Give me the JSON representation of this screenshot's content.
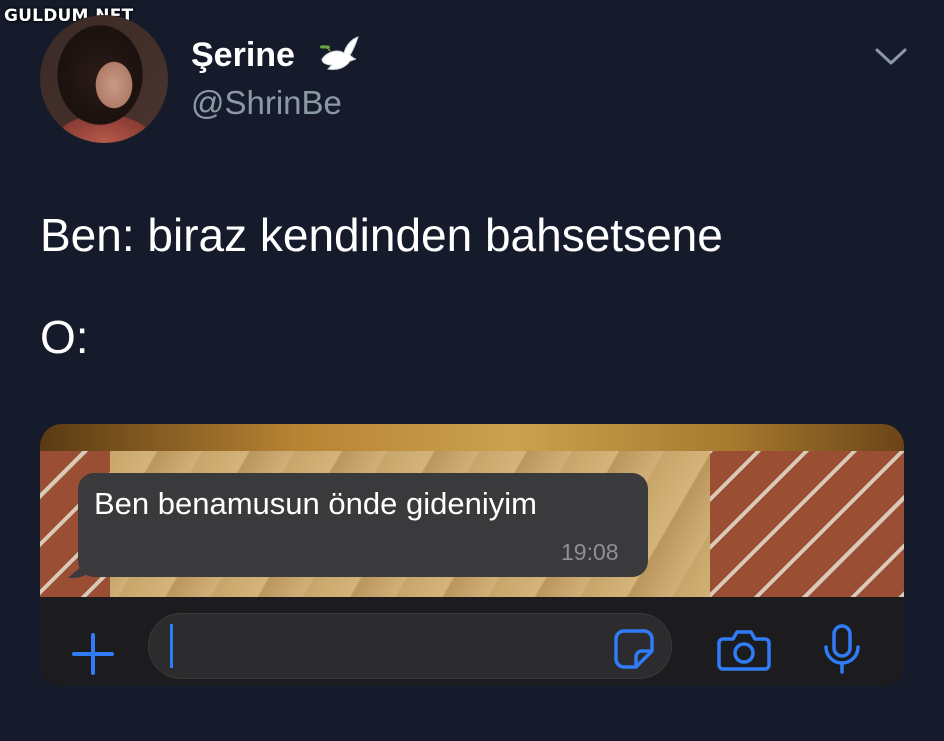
{
  "watermark": "GULDUM.NET",
  "tweet": {
    "display_name": "Şerine",
    "handle": "@ShrinBe",
    "line1": "Ben: biraz kendinden bahsetsene",
    "line2": "O:"
  },
  "chat": {
    "message": "Ben benamusun önde gideniyim",
    "time": "19:08"
  },
  "icons": {
    "dove": "dove-emoji",
    "chevron": "chevron-down-icon",
    "plus": "plus-icon",
    "sticker": "sticker-icon",
    "camera": "camera-icon",
    "mic": "microphone-icon"
  },
  "colors": {
    "background": "#161b2c",
    "handle": "#8b98a5",
    "accent": "#2f7cf6",
    "bubble": "#3a3a3c"
  }
}
